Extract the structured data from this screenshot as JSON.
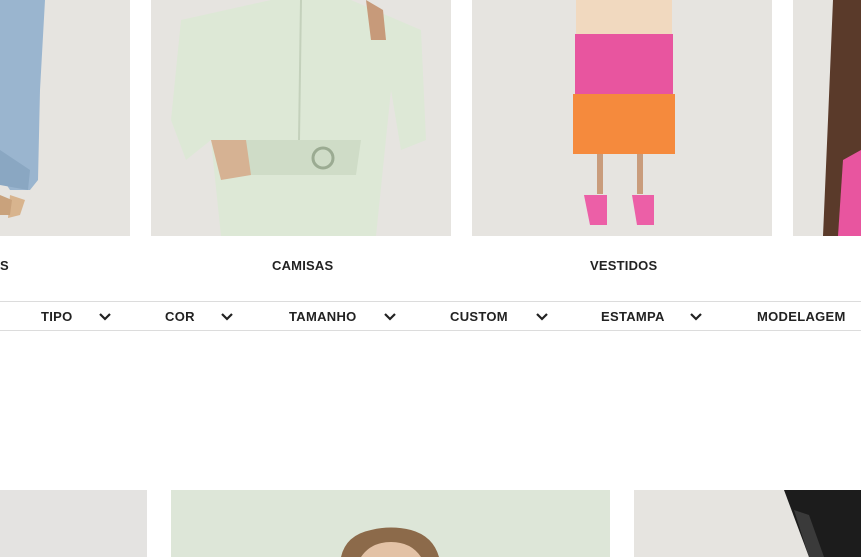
{
  "categories": [
    {
      "label": "CALÇAS",
      "visible_label": "S"
    },
    {
      "label": "CAMISAS"
    },
    {
      "label": "VESTIDOS"
    },
    {
      "label": ""
    }
  ],
  "filters": [
    {
      "label": "TIPO",
      "icon": "chevron-down-icon"
    },
    {
      "label": "COR",
      "icon": "chevron-down-icon"
    },
    {
      "label": "TAMANHO",
      "icon": "chevron-down-icon"
    },
    {
      "label": "CUSTOM",
      "icon": "chevron-down-icon"
    },
    {
      "label": "ESTAMPA",
      "icon": "chevron-down-icon"
    },
    {
      "label": "MODELAGEM",
      "icon": "chevron-down-icon"
    }
  ],
  "colors": {
    "image_bg": "#e6e4e0",
    "mint": "#dde8d6",
    "pink": "#e8559f",
    "orange": "#f58a3d",
    "peach": "#f1d9bf",
    "denim": "#9ab5cf",
    "text": "#222222",
    "divider": "#dcdcdc"
  }
}
